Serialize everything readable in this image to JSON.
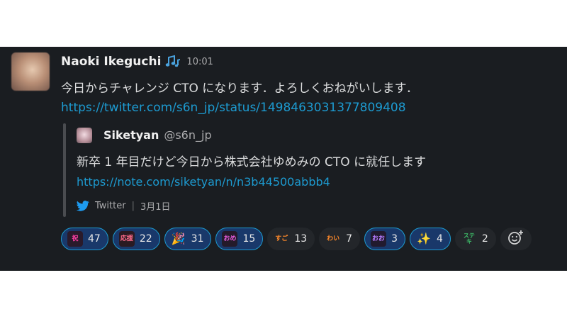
{
  "message": {
    "author": "Naoki Ikeguchi",
    "status_icon": "musical-notes-icon",
    "time": "10:01",
    "text": "今日からチャレンジ CTO になります．よろしくおねがいします．",
    "link": "https://twitter.com/s6n_jp/status/1498463031377809408"
  },
  "quote": {
    "name": "Siketyan",
    "handle": "@s6n_jp",
    "text": "新卒 1 年目だけど今日から株式会社ゆめみの CTO に就任します",
    "link": "https://note.com/siketyan/n/n3b44500abbb4",
    "source": "Twitter",
    "date": "3月1日"
  },
  "reactions": [
    {
      "emoji": "custom-pink-text-emoji",
      "glyph": "祝",
      "count": "47",
      "active": true,
      "fg": "#ff3fa4"
    },
    {
      "emoji": "custom-ouen-emoji",
      "glyph": "応援",
      "count": "22",
      "active": true,
      "fg": "#ff6b8b"
    },
    {
      "emoji": "party-popper-emoji",
      "glyph": "🎉",
      "count": "31",
      "active": true,
      "fg": "#ffcc33"
    },
    {
      "emoji": "custom-pink-text-emoji",
      "glyph": "おめ",
      "count": "15",
      "active": true,
      "fg": "#e05ad7"
    },
    {
      "emoji": "custom-orange-text-emoji",
      "glyph": "すご",
      "count": "13",
      "active": false,
      "fg": "#ff8a2a"
    },
    {
      "emoji": "custom-waiwai-emoji",
      "glyph": "わい",
      "count": "7",
      "active": false,
      "fg": "#ff8a2a"
    },
    {
      "emoji": "custom-purple-text-emoji",
      "glyph": "おお",
      "count": "3",
      "active": true,
      "fg": "#b77cff"
    },
    {
      "emoji": "sparkles-emoji",
      "glyph": "✨",
      "count": "4",
      "active": true,
      "fg": "#ffd84a"
    },
    {
      "emoji": "custom-suteki-emoji",
      "glyph": "ステキ",
      "count": "2",
      "active": false,
      "fg": "#3ec06a"
    }
  ],
  "add_reaction_icon": "add-reaction-icon"
}
